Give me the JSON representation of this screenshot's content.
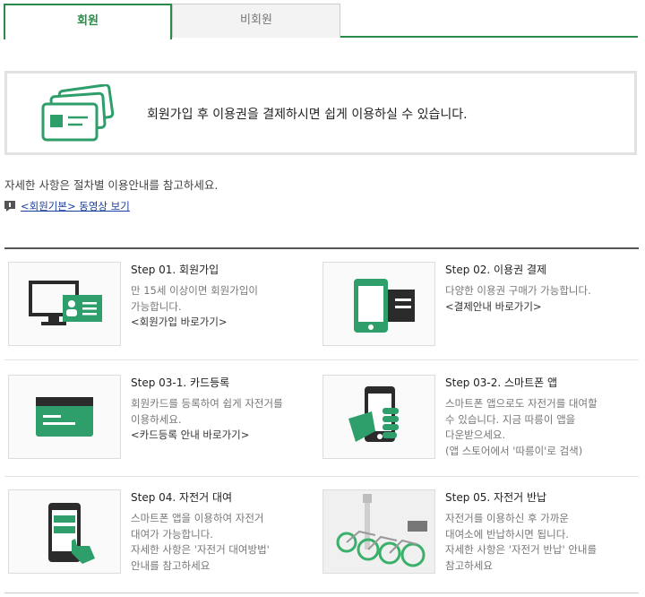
{
  "tabs": {
    "member": "회원",
    "non_member": "비회원"
  },
  "intro": {
    "text": "회원가입 후 이용권을 결제하시면 쉽게 이용하실 수 있습니다."
  },
  "detail_text": "자세한 사항은 절차별 이용안내를 참고하세요.",
  "video_link": "<회원기본> 동영상 보기",
  "steps": [
    {
      "title": "Step 01. 회원가입",
      "lines": [
        "만 15세 이상이면 회원가입이",
        "가능합니다."
      ],
      "link": "<회원가입 바로가기>",
      "icon": "computer-id-card-icon"
    },
    {
      "title": "Step 02. 이용권 결제",
      "lines": [
        "다양한 이용권 구매가 가능합니다."
      ],
      "link": "<결제안내 바로가기>",
      "icon": "phone-card-icon"
    },
    {
      "title": "Step 03-1. 카드등록",
      "lines": [
        "회원카드를 등록하여 쉽게 자전거를",
        "이용하세요."
      ],
      "link": "<카드등록 안내 바로가기>",
      "icon": "member-card-icon"
    },
    {
      "title": "Step 03-2. 스마트폰 앱",
      "lines": [
        "스마트폰 앱으로도 자전거를 대여할",
        "수 있습니다. 지금 따릉이 앱을",
        "다운받으세요.",
        "(앱 스토어에서 '따릉이'로 검색)"
      ],
      "link": "",
      "icon": "hand-phone-icon"
    },
    {
      "title": "Step 04. 자전거 대여",
      "lines": [
        "스마트폰 앱을 이용하여 자전거",
        "대여가 가능합니다.",
        "자세한 사항은 '자전거 대여방법'",
        "안내를 참고하세요"
      ],
      "link": "",
      "icon": "phone-tap-icon"
    },
    {
      "title": "Step 05. 자전거 반납",
      "lines": [
        "자전거를 이용하신 후 가까운",
        "대여소에 반납하시면 됩니다.",
        "자세한 사항은 '자전거 반납' 안내를",
        "참고하세요"
      ],
      "link": "",
      "icon": "bicycles-photo"
    }
  ],
  "colors": {
    "accent": "#2a8a4a",
    "icon_green": "#2e9e6a",
    "icon_dark": "#2b2b2b"
  }
}
